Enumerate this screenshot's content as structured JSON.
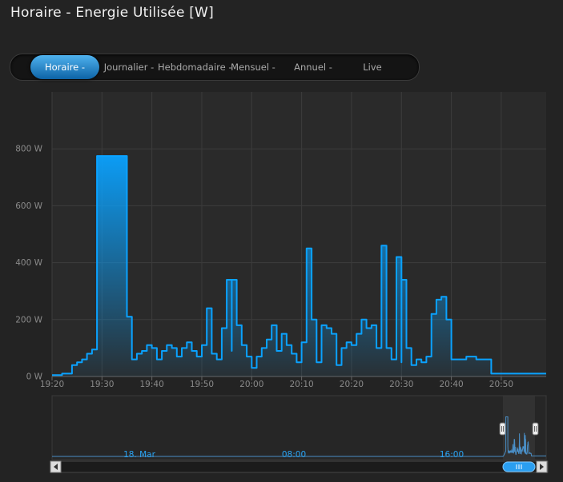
{
  "header": {
    "title": "Horaire - Energie Utilisée [W]"
  },
  "tabs": [
    {
      "label": "Horaire -",
      "active": true
    },
    {
      "label": "Journalier -",
      "active": false
    },
    {
      "label": "Hebdomadaire -",
      "active": false
    },
    {
      "label": "Mensuel -",
      "active": false
    },
    {
      "label": "Annuel -",
      "active": false
    },
    {
      "label": "Live",
      "active": false
    }
  ],
  "colors": {
    "line": "#0aa2ff",
    "background": "#232323",
    "grid": "#3c3c3c",
    "accent": "#1f8ee0"
  },
  "chart_data": {
    "type": "area",
    "xlabel": "",
    "ylabel": "",
    "x_unit": "minute",
    "xlim": [
      "19:20",
      "20:59"
    ],
    "ylim": [
      0,
      1000
    ],
    "yticks": [
      0,
      200,
      400,
      600,
      800
    ],
    "ytick_labels": [
      "0 W",
      "200 W",
      "400 W",
      "600 W",
      "800 W"
    ],
    "xtick_labels": [
      "19:20",
      "19:30",
      "19:40",
      "19:50",
      "20:00",
      "20:10",
      "20:20",
      "20:30",
      "20:40",
      "20:50"
    ],
    "grid": true,
    "series": [
      {
        "x": [
          "19:20",
          "19:22",
          "19:24",
          "19:25",
          "19:26",
          "19:27",
          "19:28",
          "19:29",
          "19:29",
          "19:35",
          "19:35",
          "19:36",
          "19:37",
          "19:38",
          "19:39",
          "19:40",
          "19:41",
          "19:42",
          "19:43",
          "19:44",
          "19:45",
          "19:46",
          "19:47",
          "19:48",
          "19:49",
          "19:50",
          "19:51",
          "19:52",
          "19:53",
          "19:54",
          "19:55",
          "19:56",
          "19:56",
          "19:57",
          "19:58",
          "19:58",
          "19:59",
          "20:00",
          "20:01",
          "20:02",
          "20:03",
          "20:04",
          "20:05",
          "20:06",
          "20:07",
          "20:08",
          "20:09",
          "20:10",
          "20:11",
          "20:11",
          "20:12",
          "20:13",
          "20:14",
          "20:15",
          "20:16",
          "20:17",
          "20:18",
          "20:19",
          "20:20",
          "20:21",
          "20:22",
          "20:23",
          "20:24",
          "20:25",
          "20:26",
          "20:26",
          "20:27",
          "20:28",
          "20:29",
          "20:30",
          "20:30",
          "20:31",
          "20:32",
          "20:33",
          "20:34",
          "20:35",
          "20:36",
          "20:37",
          "20:37",
          "20:38",
          "20:39",
          "20:40",
          "20:41",
          "20:42",
          "20:43",
          "20:44",
          "20:45",
          "20:46",
          "20:47",
          "20:48",
          "20:49",
          "20:50",
          "20:55",
          "20:59"
        ],
        "y": [
          5,
          10,
          40,
          50,
          60,
          80,
          95,
          110,
          775,
          775,
          210,
          60,
          80,
          90,
          110,
          100,
          60,
          90,
          110,
          100,
          70,
          100,
          120,
          90,
          70,
          110,
          240,
          80,
          60,
          170,
          340,
          90,
          340,
          180,
          180,
          110,
          70,
          30,
          70,
          100,
          130,
          180,
          90,
          150,
          110,
          80,
          50,
          120,
          360,
          450,
          200,
          50,
          180,
          170,
          150,
          40,
          100,
          120,
          110,
          150,
          200,
          170,
          180,
          100,
          100,
          460,
          100,
          60,
          420,
          50,
          340,
          100,
          40,
          60,
          50,
          70,
          220,
          230,
          270,
          280,
          200,
          60,
          60,
          60,
          70,
          70,
          60,
          60,
          60,
          10,
          10,
          10,
          10,
          10
        ]
      }
    ],
    "navigator": {
      "xtick_labels": [
        "18. Mar",
        "08:00",
        "16:00"
      ]
    }
  }
}
